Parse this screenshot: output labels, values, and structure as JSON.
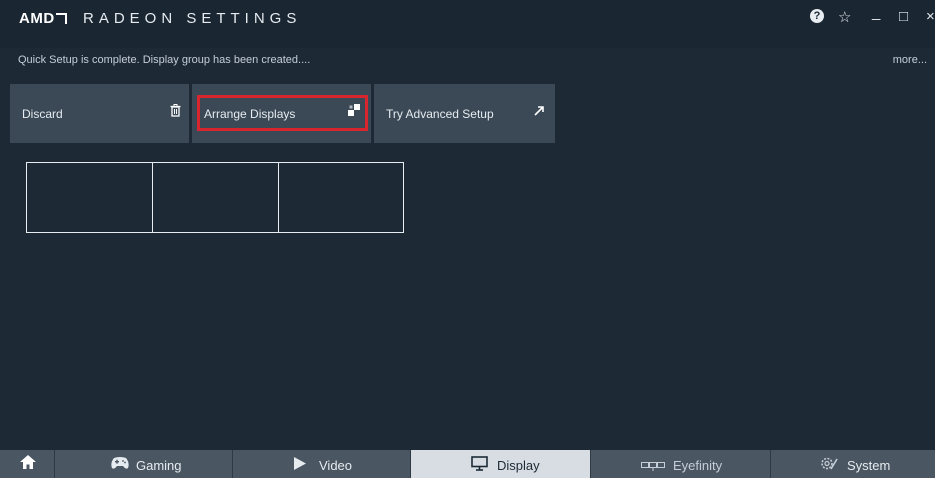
{
  "header": {
    "brand": "AMD",
    "app_title": "RADEON SETTINGS",
    "help_glyph": "?",
    "star_glyph": "☆",
    "minimize_glyph": "_",
    "maximize_glyph": "□",
    "close_glyph": "×"
  },
  "status": {
    "message": "Quick Setup is complete. Display group has been created....",
    "more_label": "more..."
  },
  "actions": {
    "discard_label": "Discard",
    "discard_icon": "🗑",
    "arrange_label": "Arrange Displays",
    "arrange_icon": "▞",
    "advanced_label": "Try Advanced Setup",
    "advanced_icon": "↗"
  },
  "nav": {
    "home_icon": "⌂",
    "tabs": [
      {
        "label": "Gaming",
        "icon": "🎮"
      },
      {
        "label": "Video",
        "icon": "▶"
      },
      {
        "label": "Display",
        "icon": "▭"
      },
      {
        "label": "Eyefinity",
        "icon": "▭▭"
      },
      {
        "label": "System",
        "icon": "⚙"
      }
    ],
    "active_tab": "Display"
  },
  "colors": {
    "background": "#1d2a36",
    "button": "#3a4955",
    "highlight": "#d8262e",
    "active_tab": "#d7dde3"
  }
}
